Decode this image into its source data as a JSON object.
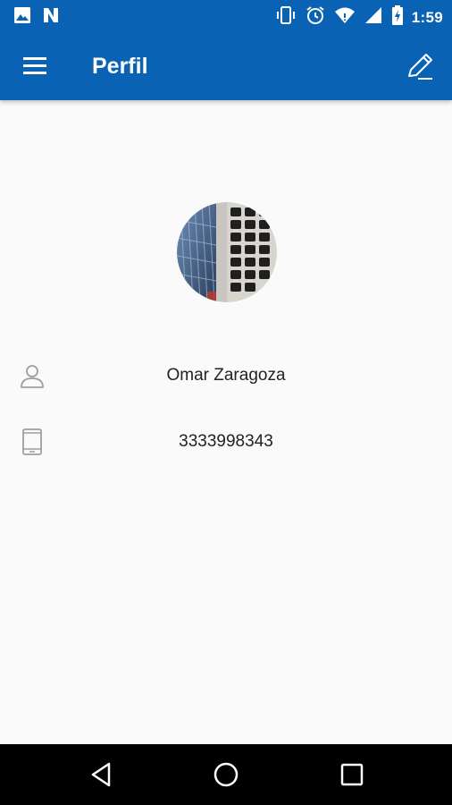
{
  "status_bar": {
    "time": "1:59",
    "left_icons": [
      "image-notification-icon",
      "n-notification-icon"
    ],
    "right_icons": [
      "vibrate-icon",
      "alarm-icon",
      "wifi-icon",
      "signal-icon",
      "battery-charging-icon"
    ]
  },
  "app_bar": {
    "title": "Perfil",
    "menu_icon": "hamburger-menu-icon",
    "edit_icon": "pencil-edit-icon"
  },
  "profile": {
    "avatar": "profile-photo-keyboard",
    "name": "Omar Zaragoza",
    "name_icon": "person-icon",
    "phone": "3333998343",
    "phone_icon": "tablet-phone-icon"
  },
  "nav_bar": {
    "buttons": [
      "back-triangle-icon",
      "home-circle-icon",
      "recents-square-icon"
    ]
  },
  "colors": {
    "primary": "#0a62b5",
    "background": "#fafafa",
    "text": "#222222",
    "icon_gray": "#9e9e9e",
    "nav_bg": "#000000"
  }
}
